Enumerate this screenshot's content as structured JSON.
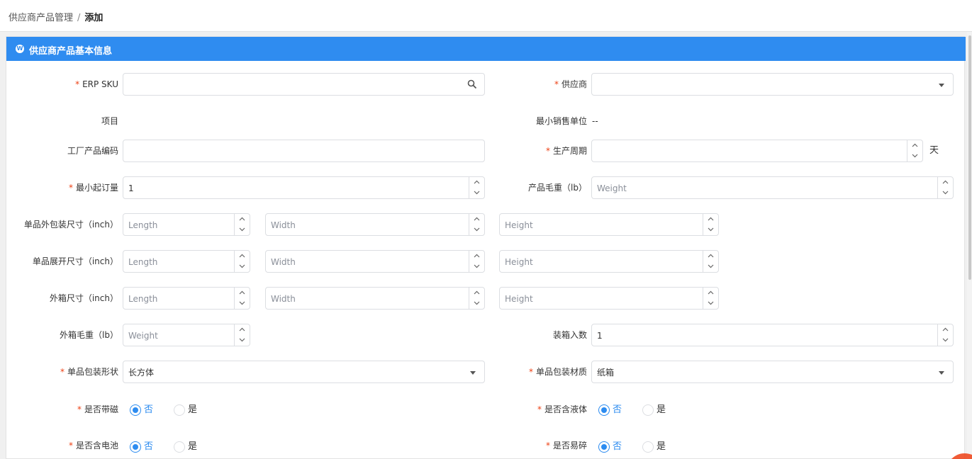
{
  "breadcrumb": {
    "parent": "供应商产品管理",
    "separator": "/",
    "current": "添加"
  },
  "panel": {
    "title": "供应商产品基本信息",
    "icon": "wordpress-icon"
  },
  "fields": {
    "erp_sku": {
      "label": "ERP SKU",
      "value": "",
      "icon": "search-icon"
    },
    "supplier": {
      "label": "供应商",
      "value": ""
    },
    "item": {
      "label": "项目",
      "value": ""
    },
    "min_sales_unit": {
      "label": "最小销售单位",
      "value": "--"
    },
    "factory_code": {
      "label": "工厂产品编码",
      "value": ""
    },
    "production_cycle": {
      "label": "生产周期",
      "value": "",
      "unit": "天"
    },
    "moq": {
      "label": "最小起订量",
      "value": "1"
    },
    "gross_weight": {
      "label": "产品毛重（lb）",
      "placeholder": "Weight"
    },
    "pack_size": {
      "label": "单品外包装尺寸（inch）",
      "ph_length": "Length",
      "ph_width": "Width",
      "ph_height": "Height"
    },
    "unfold_size": {
      "label": "单品展开尺寸（inch）",
      "ph_length": "Length",
      "ph_width": "Width",
      "ph_height": "Height"
    },
    "carton_size": {
      "label": "外箱尺寸（inch）",
      "ph_length": "Length",
      "ph_width": "Width",
      "ph_height": "Height"
    },
    "carton_weight": {
      "label": "外箱毛重（lb）",
      "placeholder": "Weight"
    },
    "carton_qty": {
      "label": "装箱入数",
      "value": "1"
    },
    "pack_shape": {
      "label": "单品包装形状",
      "value": "长方体"
    },
    "pack_material": {
      "label": "单品包装材质",
      "value": "纸箱"
    },
    "magnetic": {
      "label": "是否带磁",
      "options": [
        "否",
        "是"
      ],
      "selected": "否"
    },
    "liquid": {
      "label": "是否含液体",
      "options": [
        "否",
        "是"
      ],
      "selected": "否"
    },
    "battery": {
      "label": "是否含电池",
      "options": [
        "否",
        "是"
      ],
      "selected": "否"
    },
    "fragile": {
      "label": "是否易碎",
      "options": [
        "否",
        "是"
      ],
      "selected": "否"
    }
  },
  "colors": {
    "primary": "#2f8cf0",
    "required": "#ed4014",
    "border": "#dcdee2"
  }
}
